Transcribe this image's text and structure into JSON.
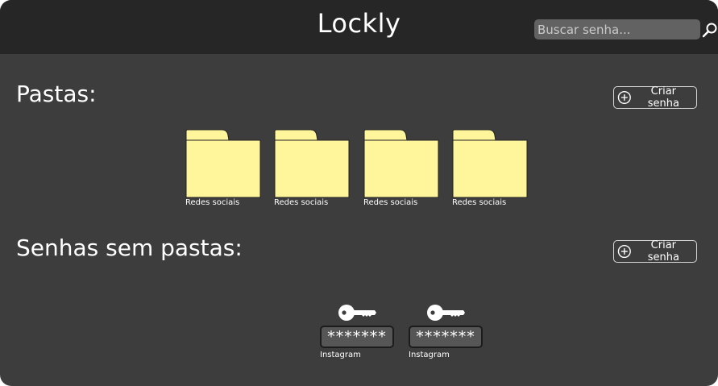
{
  "app": {
    "title": "Lockly"
  },
  "search": {
    "placeholder": "Buscar senha..."
  },
  "folders_section": {
    "title": "Pastas:",
    "create_label": "Criar senha",
    "folders": [
      {
        "label": "Redes sociais"
      },
      {
        "label": "Redes sociais"
      },
      {
        "label": "Redes sociais"
      },
      {
        "label": "Redes sociais"
      }
    ]
  },
  "passwords_section": {
    "title": "Senhas sem pastas:",
    "create_label": "Criar senha",
    "items": [
      {
        "masked": "*******",
        "label": "Instagram"
      },
      {
        "masked": "*******",
        "label": "Instagram"
      }
    ]
  },
  "colors": {
    "background": "#3d3d3d",
    "topbar": "#262626",
    "folder": "#fff59a",
    "text": "#ffffff"
  },
  "icons": [
    "search-icon",
    "plus-circle-icon",
    "folder-icon",
    "key-icon"
  ]
}
